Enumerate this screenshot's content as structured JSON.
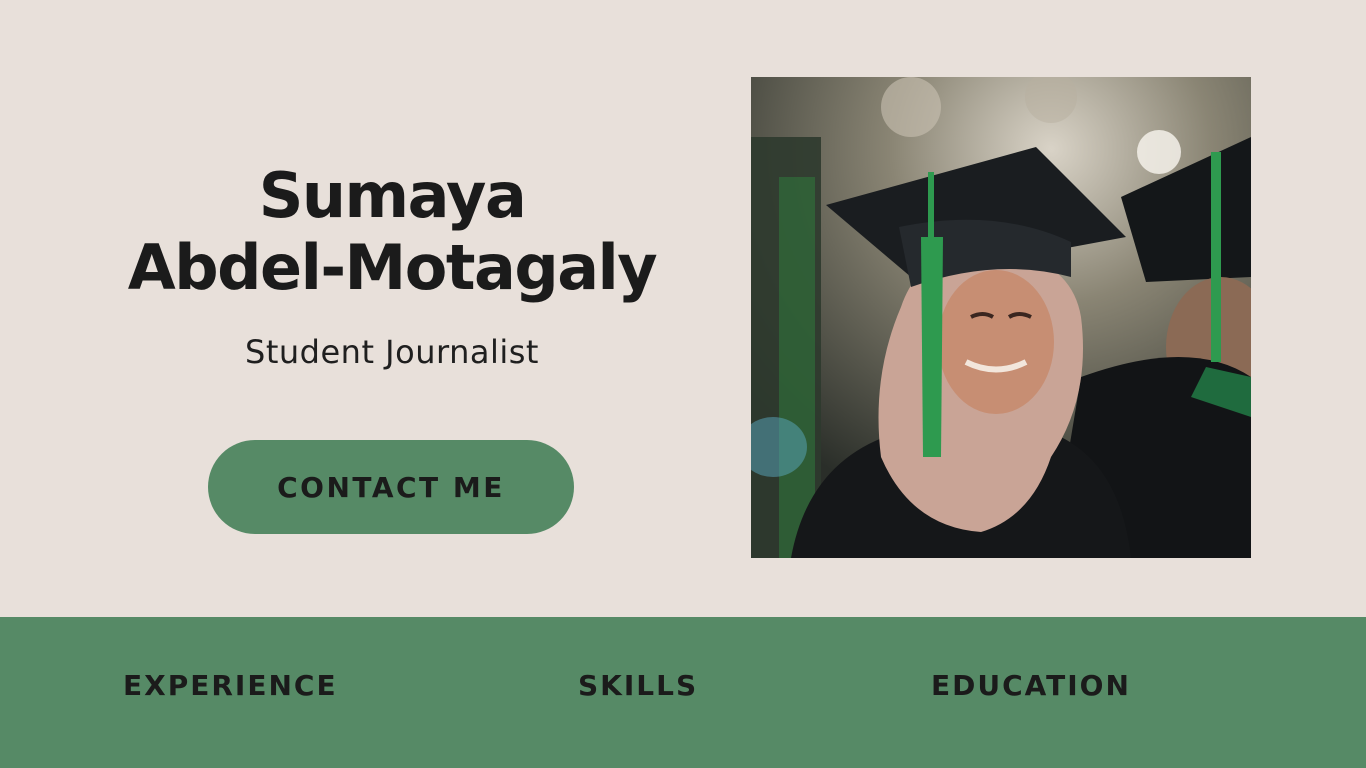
{
  "profile": {
    "name_line1": "Sumaya",
    "name_line2": "Abdel-Motagaly",
    "role": "Student Journalist",
    "contact_label": "CONTACT ME"
  },
  "photo": {
    "alt": "Graduate in cap and gown with green tassel smiling at ceremony"
  },
  "nav": {
    "items": [
      {
        "label": "EXPERIENCE"
      },
      {
        "label": "SKILLS"
      },
      {
        "label": "EDUCATION"
      }
    ]
  },
  "colors": {
    "background": "#e8e0da",
    "accent_green": "#568a66",
    "text": "#1b1b1b"
  }
}
